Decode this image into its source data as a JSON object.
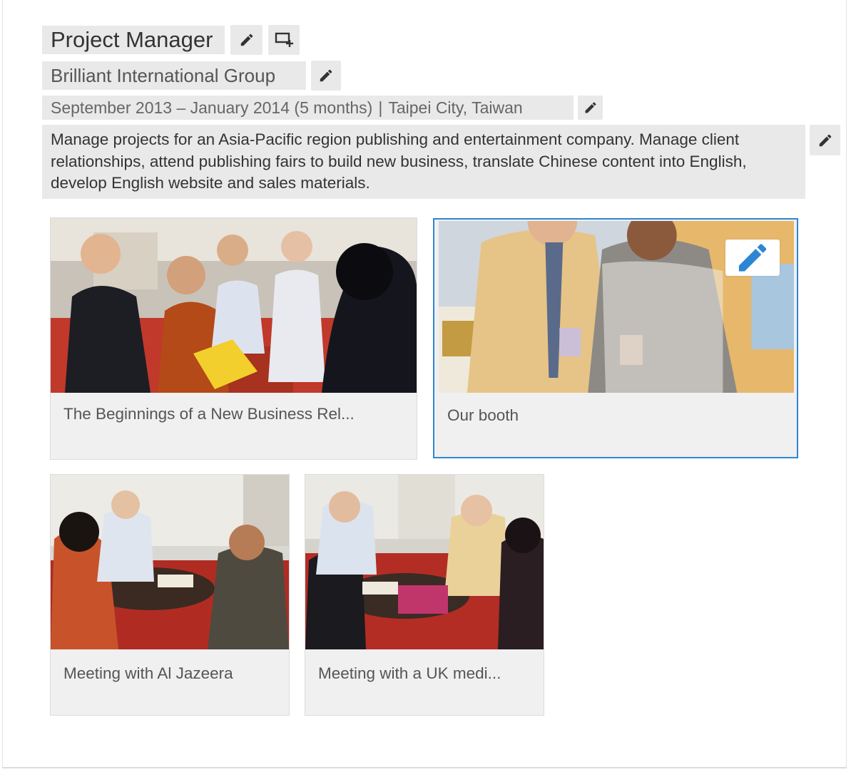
{
  "position": {
    "title": "Project Manager",
    "company": "Brilliant International Group",
    "date_range": "September 2013 – January 2014 (5 months)",
    "separator": "|",
    "location": "Taipei City, Taiwan",
    "description": "Manage projects for an Asia-Pacific region publishing and entertainment company. Manage client relationships, attend publishing fairs to build new business, translate Chinese content into English, develop English website and sales materials."
  },
  "media": [
    {
      "caption": "The Beginnings of a New Business Rel..."
    },
    {
      "caption": "Our booth"
    },
    {
      "caption": "Meeting with Al Jazeera"
    },
    {
      "caption": "Meeting with a UK medi..."
    }
  ],
  "colors": {
    "field_bg": "#e9e9e9",
    "selected_border": "#2d86d3",
    "edit_icon": "#333333",
    "photo_edit_icon": "#2d86d3"
  },
  "icons": {
    "edit": "pencil-icon",
    "add_media": "add-media-icon"
  }
}
